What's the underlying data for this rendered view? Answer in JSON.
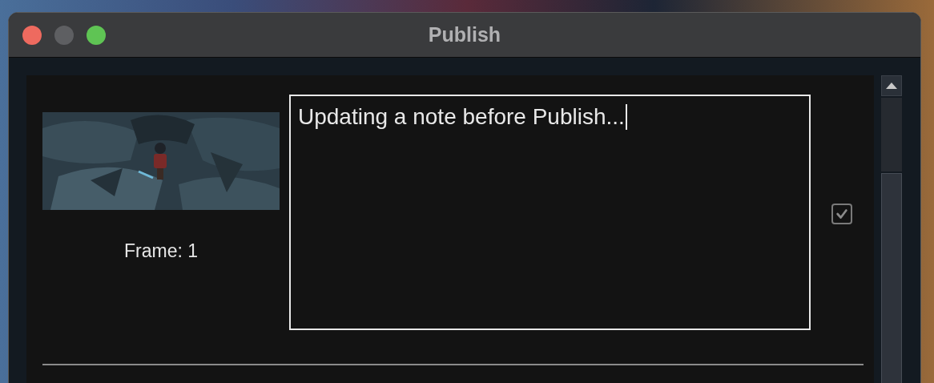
{
  "window": {
    "title": "Publish"
  },
  "items": [
    {
      "frame_label": "Frame: 1",
      "note": "Updating a note before Publish...",
      "checked": true
    }
  ]
}
